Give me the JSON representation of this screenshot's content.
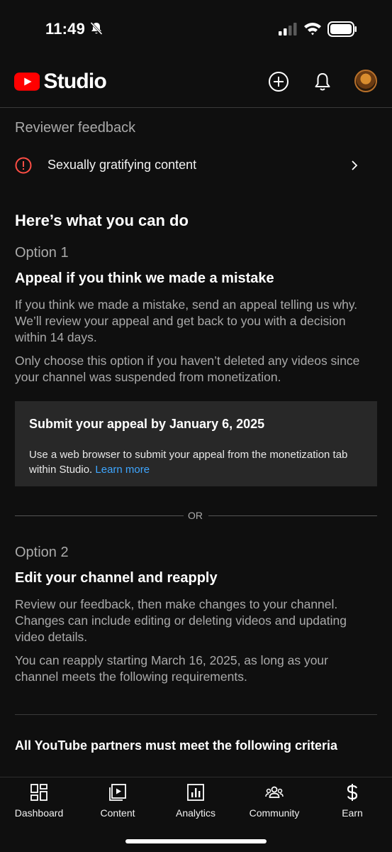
{
  "status_bar": {
    "time": "11:49"
  },
  "header": {
    "logo_text": "Studio",
    "brand_color": "#ff0000"
  },
  "feedback": {
    "title": "Reviewer feedback",
    "item": "Sexually gratifying content",
    "alert_color": "#ff4e45"
  },
  "what_you_can_do": "Here’s what you can do",
  "option1": {
    "label": "Option 1",
    "heading": "Appeal if you think we made a mistake",
    "para1": "If you think we made a mistake, send an appeal telling us why. We’ll review your appeal and get back to you with a decision within 14 days.",
    "para2": "Only choose this option if you haven’t deleted any videos since your channel was suspended from monetization.",
    "box_title": "Submit your appeal by January 6, 2025",
    "box_body": "Use a web browser to submit your appeal from the monetization tab within Studio.",
    "box_link": "Learn more"
  },
  "or_text": "OR",
  "option2": {
    "label": "Option 2",
    "heading": "Edit your channel and reapply",
    "para1": "Review our feedback, then make changes to your channel. Changes can include editing or deleting videos and updating video details.",
    "para2": "You can reapply starting March 16, 2025, as long as your channel meets the following requirements."
  },
  "criteria_heading": "All YouTube partners must meet the following criteria",
  "nav": [
    {
      "label": "Dashboard",
      "icon": "dashboard-icon"
    },
    {
      "label": "Content",
      "icon": "content-icon"
    },
    {
      "label": "Analytics",
      "icon": "analytics-icon"
    },
    {
      "label": "Community",
      "icon": "community-icon"
    },
    {
      "label": "Earn",
      "icon": "earn-icon"
    }
  ]
}
